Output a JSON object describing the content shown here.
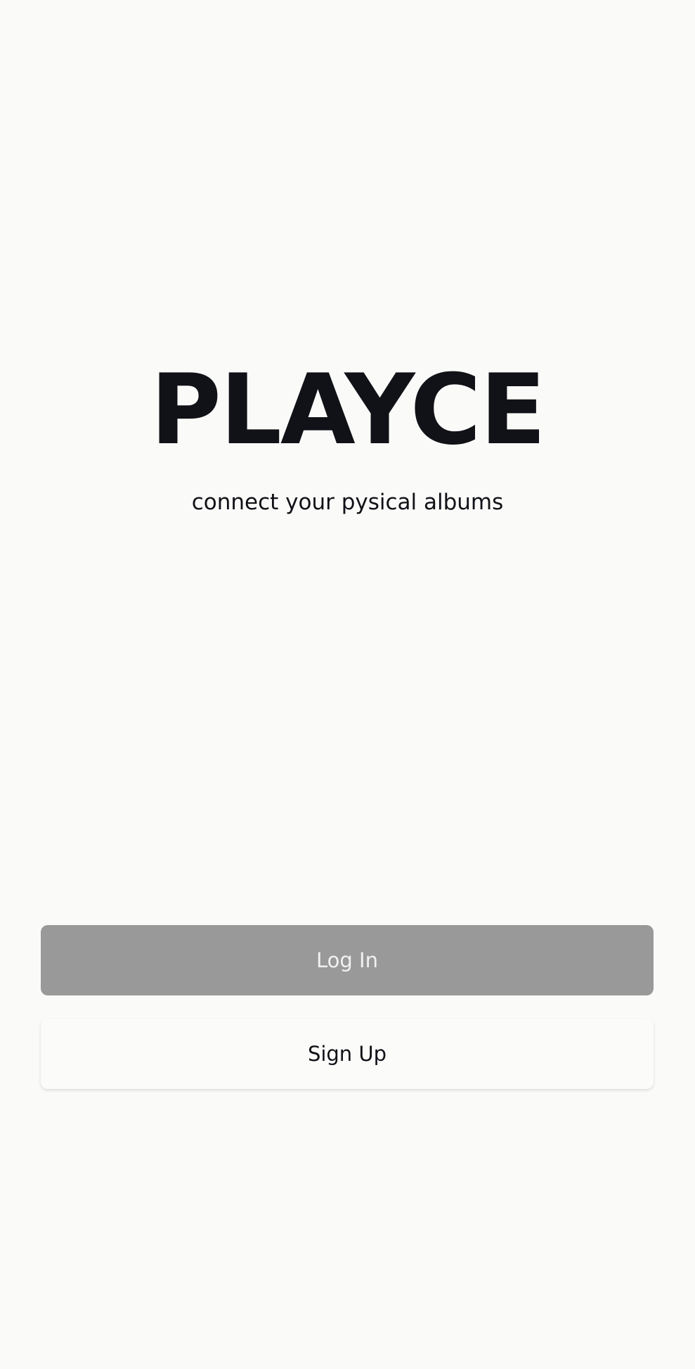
{
  "app": {
    "title": "PLAYCE",
    "tagline": "connect your pysical albums"
  },
  "actions": {
    "login_label": "Log In",
    "signup_label": "Sign Up"
  },
  "colors": {
    "background": "#fafaf9",
    "login_button": "#999999",
    "text": "#111217"
  }
}
